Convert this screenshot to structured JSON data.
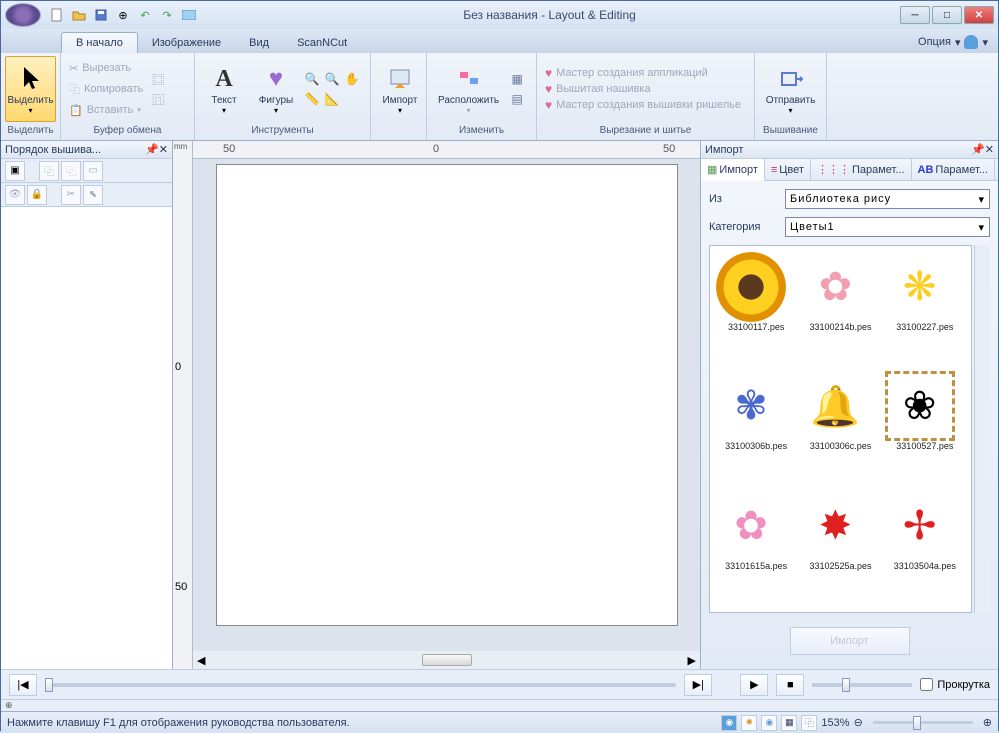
{
  "title": "Без названия - Layout & Editing",
  "qat": [
    "new",
    "open",
    "save",
    "grid",
    "undo",
    "redo",
    "view"
  ],
  "tabs": {
    "items": [
      "В начало",
      "Изображение",
      "Вид",
      "ScanNCut"
    ],
    "active": 0,
    "option": "Опция"
  },
  "ribbon": {
    "select": {
      "label": "Выделить",
      "group": "Выделить"
    },
    "clipboard": {
      "cut": "Вырезать",
      "copy": "Копировать",
      "paste": "Вставить",
      "group": "Буфер обмена"
    },
    "tools": {
      "text": "Текст",
      "shapes": "Фигуры",
      "group": "Инструменты"
    },
    "import": {
      "label": "Импорт"
    },
    "arrange": {
      "label": "Расположить",
      "group": "Изменить"
    },
    "wizards": {
      "applique": "Мастер создания аппликаций",
      "patch": "Вышитая нашивка",
      "richelieu": "Мастер создания вышивки ришелье",
      "group": "Вырезание и шитье"
    },
    "send": {
      "label": "Отправить",
      "group": "Вышивание"
    }
  },
  "leftpanel": {
    "title": "Порядок вышива..."
  },
  "ruler": {
    "unit": "mm",
    "marks": [
      "50",
      "0",
      "50"
    ],
    "vmark": "50"
  },
  "rightpanel": {
    "title": "Импорт",
    "tabs": [
      "Импорт",
      "Цвет",
      "Парамет...",
      "Парамет..."
    ],
    "from_label": "Из",
    "from_value": "Библиотека рису",
    "cat_label": "Категория",
    "cat_value": "Цветы1",
    "import_btn": "Импорт"
  },
  "gallery": [
    {
      "name": "33100117.pes",
      "cls": "sunflower"
    },
    {
      "name": "33100214b.pes",
      "cls": "pinkflower",
      "glyph": "✿"
    },
    {
      "name": "33100227.pes",
      "cls": "yellowdaisy",
      "glyph": "❋"
    },
    {
      "name": "33100306b.pes",
      "cls": "blueflower",
      "glyph": "✾"
    },
    {
      "name": "33100306c.pes",
      "cls": "bellflower",
      "glyph": "🔔"
    },
    {
      "name": "33100527.pes",
      "cls": "bouquet",
      "glyph": "❀"
    },
    {
      "name": "33101615a.pes",
      "cls": "tulip",
      "glyph": "✿"
    },
    {
      "name": "33102525a.pes",
      "cls": "redstar",
      "glyph": "✸"
    },
    {
      "name": "33103504a.pes",
      "cls": "redcross",
      "glyph": "✢"
    }
  ],
  "playback": {
    "scroll_label": "Прокрутка"
  },
  "status": {
    "hint": "Нажмите клавишу F1 для отображения руководства пользователя.",
    "zoom": "153%"
  }
}
